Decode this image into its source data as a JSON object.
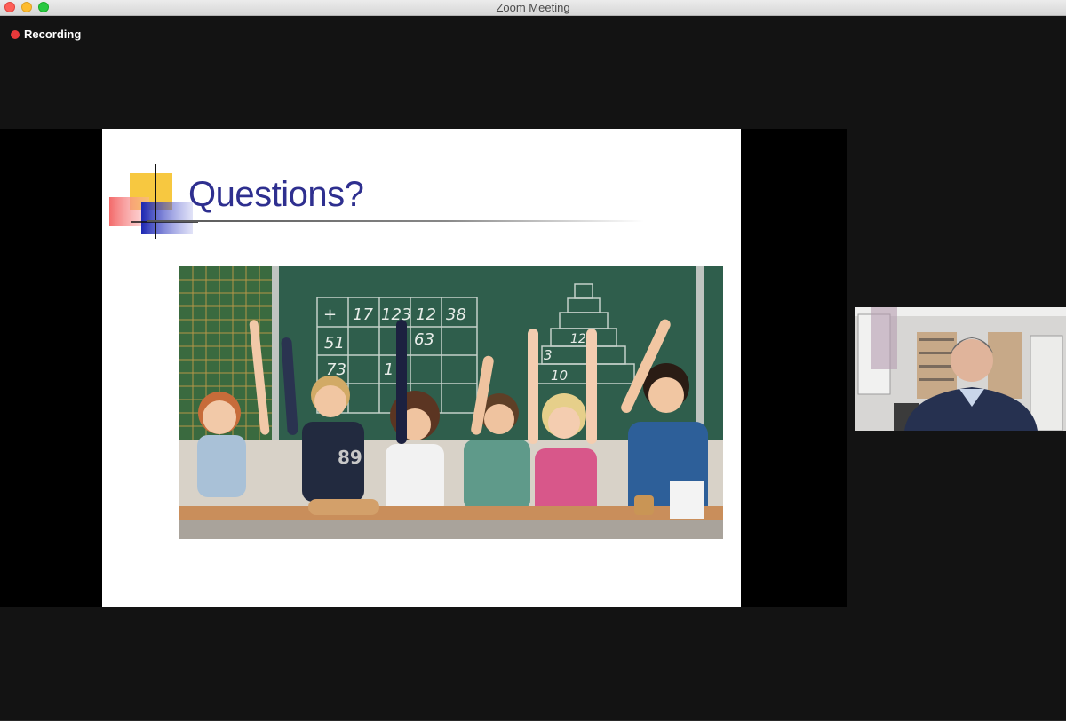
{
  "window": {
    "title": "Zoom Meeting"
  },
  "recording": {
    "label": "Recording",
    "color": "#e8393a"
  },
  "slide": {
    "title": "Questions?",
    "title_color": "#2e2f8f",
    "image": {
      "description_icon": "classroom-photo",
      "board_numbers": [
        "+",
        "17",
        "123",
        "12",
        "38",
        "51",
        "63",
        "73",
        "1"
      ],
      "pyramid_numbers": [
        "3",
        "12",
        "10"
      ],
      "shirt_number": "89"
    }
  },
  "participant": {
    "video_icon": "participant-video"
  }
}
